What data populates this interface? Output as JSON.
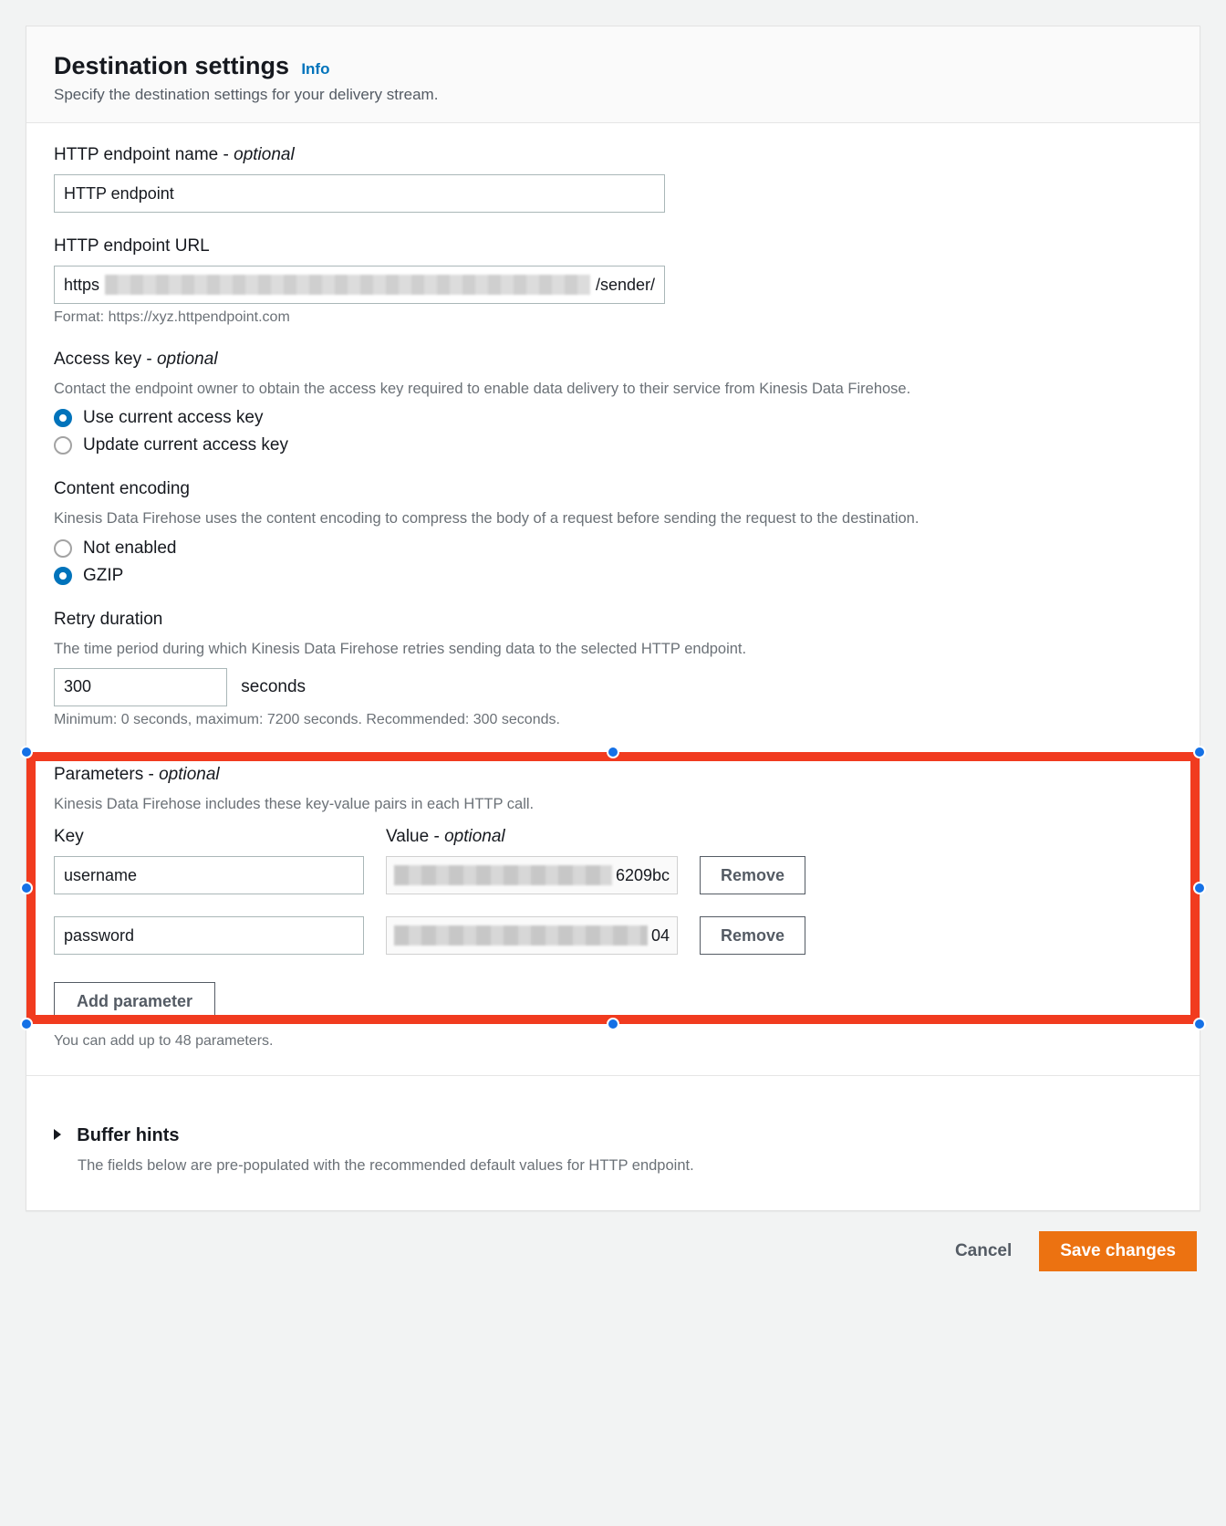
{
  "header": {
    "title": "Destination settings",
    "info": "Info",
    "subtitle": "Specify the destination settings for your delivery stream."
  },
  "endpoint_name": {
    "label": "HTTP endpoint name - ",
    "optional": "optional",
    "value": "HTTP endpoint"
  },
  "endpoint_url": {
    "label": "HTTP endpoint URL",
    "prefix": "https",
    "suffix": "/sender/",
    "hint": "Format: https://xyz.httpendpoint.com"
  },
  "access_key": {
    "label": "Access key - ",
    "optional": "optional",
    "desc": "Contact the endpoint owner to obtain the access key required to enable data delivery to their service from Kinesis Data Firehose.",
    "options": [
      "Use current access key",
      "Update current access key"
    ],
    "selected": 0
  },
  "content_encoding": {
    "label": "Content encoding",
    "desc": "Kinesis Data Firehose uses the content encoding to compress the body of a request before sending the request to the destination.",
    "options": [
      "Not enabled",
      "GZIP"
    ],
    "selected": 1
  },
  "retry": {
    "label": "Retry duration",
    "desc": "The time period during which Kinesis Data Firehose retries sending data to the selected HTTP endpoint.",
    "value": "300",
    "unit": "seconds",
    "hint": "Minimum: 0 seconds, maximum: 7200 seconds. Recommended: 300 seconds."
  },
  "parameters": {
    "label": "Parameters - ",
    "optional": "optional",
    "desc": "Kinesis Data Firehose includes these key-value pairs in each HTTP call.",
    "key_header": "Key",
    "value_header": "Value - ",
    "value_optional": "optional",
    "rows": [
      {
        "key": "username",
        "value_suffix": "6209bc"
      },
      {
        "key": "password",
        "value_suffix": "04"
      }
    ],
    "remove_label": "Remove",
    "add_label": "Add parameter",
    "hint": "You can add up to 48 parameters."
  },
  "buffer": {
    "title": "Buffer hints",
    "desc": "The fields below are pre-populated with the recommended default values for HTTP endpoint."
  },
  "footer": {
    "cancel": "Cancel",
    "save": "Save changes"
  }
}
